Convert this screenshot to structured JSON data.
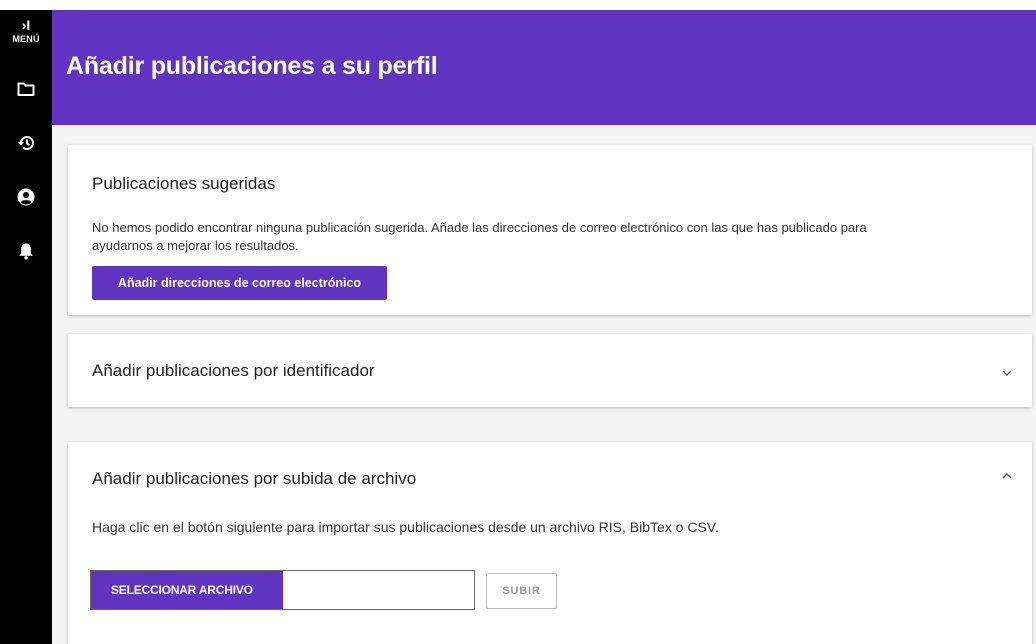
{
  "sidebar": {
    "toggle_glyph": "›I",
    "menu_label": "MENÚ",
    "icons": [
      "folder-icon",
      "history-icon",
      "account-circle-icon",
      "bell-icon"
    ]
  },
  "header": {
    "title": "Añadir publicaciones a su perfil",
    "background": "#5f34c0"
  },
  "suggested": {
    "title": "Publicaciones sugeridas",
    "text_line1": "No hemos podido encontrar ninguna publicación sugerida. Añade las direcciones de correo electrónico con las que has publicado para",
    "text_line2": "ayudarnos a mejorar los resultados.",
    "button_label": "Añadir direcciones de correo electrónico"
  },
  "by_identifier": {
    "title": "Añadir publicaciones por identificador",
    "expanded": false
  },
  "by_file": {
    "title": "Añadir publicaciones por subida de archivo",
    "expanded": true,
    "description": "Haga clic en el botón siguiente para importar sus publicaciones desde un archivo RIS, BibTex o CSV.",
    "select_button_label": "SELECCIONAR ARCHIVO",
    "file_name": "",
    "upload_button_label": "SUBIR"
  },
  "colors": {
    "accent": "#5f34c0",
    "sidebar": "#000000",
    "page_background": "#f4f4f4"
  }
}
